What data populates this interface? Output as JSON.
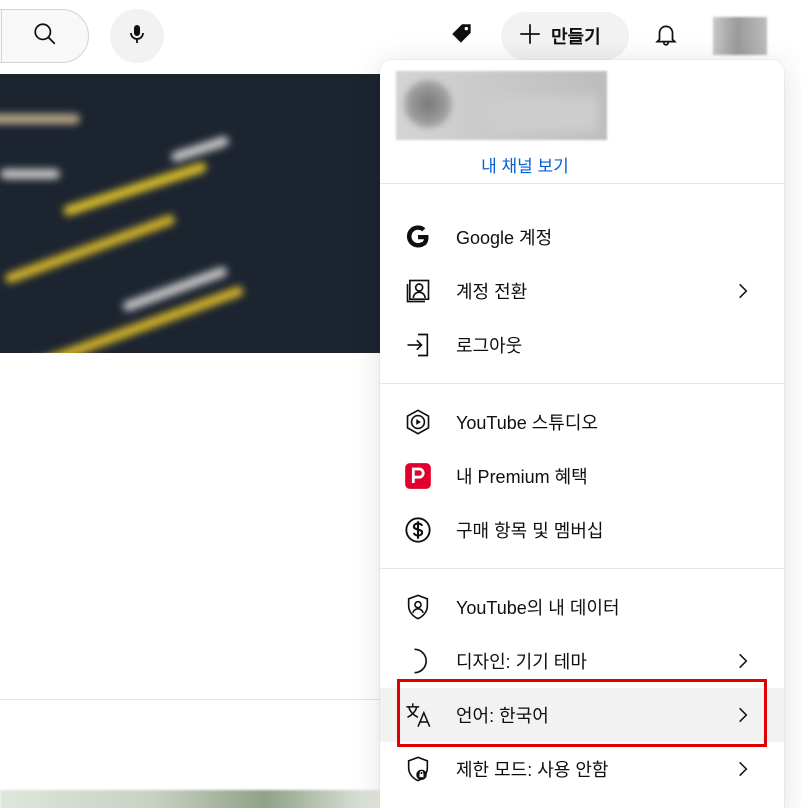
{
  "topbar": {
    "search_icon": "search-icon",
    "mic_icon": "microphone-icon",
    "tag_icon": "tag-icon",
    "create_label": "만들기",
    "bell_icon": "bell-icon"
  },
  "menu": {
    "channel_link": "내 채널 보기",
    "sections": [
      {
        "items": [
          {
            "name": "google-account",
            "icon": "google-icon",
            "label": "Google 계정",
            "chevron": false
          },
          {
            "name": "switch-account",
            "icon": "switch-account-icon",
            "label": "계정 전환",
            "chevron": true
          },
          {
            "name": "sign-out",
            "icon": "sign-out-icon",
            "label": "로그아웃",
            "chevron": false
          }
        ]
      },
      {
        "items": [
          {
            "name": "youtube-studio",
            "icon": "studio-icon",
            "label": "YouTube 스튜디오",
            "chevron": false
          },
          {
            "name": "premium-benefits",
            "icon": "premium-icon",
            "label": "내 Premium 혜택",
            "chevron": false
          },
          {
            "name": "purchases-memberships",
            "icon": "dollar-icon",
            "label": "구매 항목 및 멤버십",
            "chevron": false
          }
        ]
      },
      {
        "items": [
          {
            "name": "your-data",
            "icon": "shield-person-icon",
            "label": "YouTube의 내 데이터",
            "chevron": false
          },
          {
            "name": "appearance",
            "icon": "moon-icon",
            "label": "디자인: 기기 테마",
            "chevron": true
          },
          {
            "name": "language",
            "icon": "translate-icon",
            "label": "언어: 한국어",
            "chevron": true,
            "active": true
          },
          {
            "name": "restricted-mode",
            "icon": "restricted-shield-icon",
            "label": "제한 모드: 사용 안함",
            "chevron": true
          }
        ]
      }
    ]
  },
  "colors": {
    "link": "#065fd4",
    "premium": "#e1002d",
    "highlight_box": "#e00000",
    "active_row": "#f2f2f2"
  }
}
